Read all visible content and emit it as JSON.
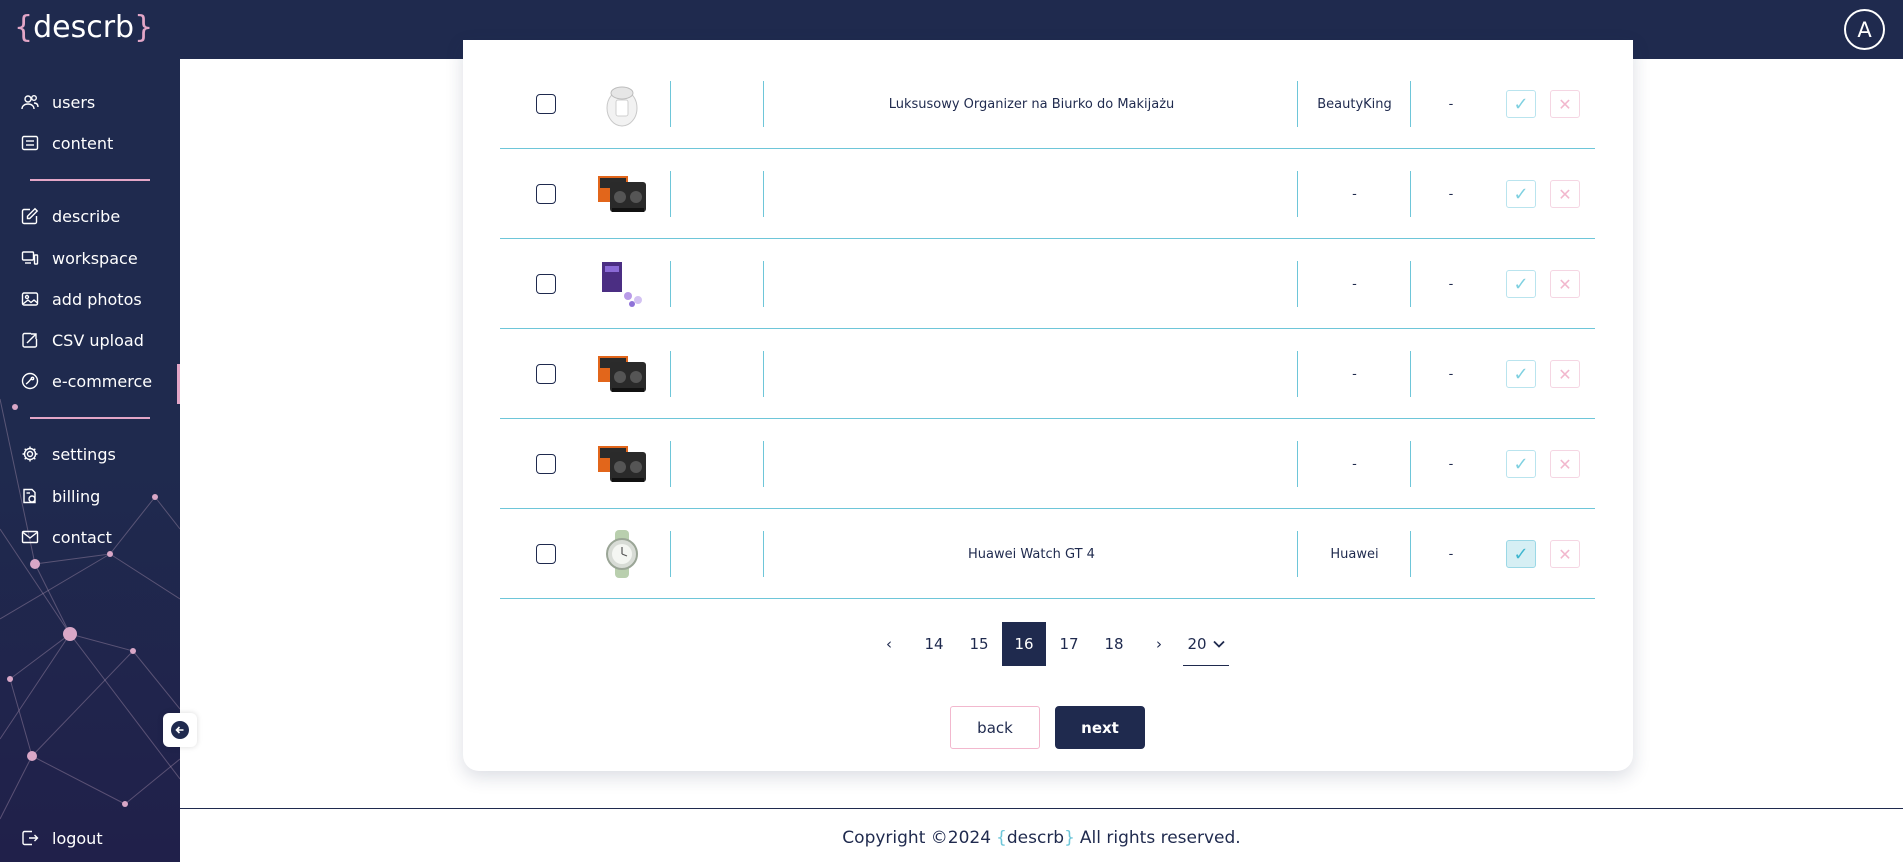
{
  "brand": {
    "open": "{",
    "name": "descrb",
    "close": "}"
  },
  "user": {
    "avatar_letter": "A"
  },
  "sidebar": {
    "items": [
      {
        "label": "users",
        "icon": "users-icon"
      },
      {
        "label": "content",
        "icon": "content-icon"
      },
      {
        "label": "describe",
        "icon": "edit-icon"
      },
      {
        "label": "workspace",
        "icon": "workspace-icon"
      },
      {
        "label": "add photos",
        "icon": "image-icon"
      },
      {
        "label": "CSV upload",
        "icon": "upload-icon"
      },
      {
        "label": "e-commerce",
        "icon": "ecommerce-icon"
      },
      {
        "label": "settings",
        "icon": "gear-icon"
      },
      {
        "label": "billing",
        "icon": "billing-icon"
      },
      {
        "label": "contact",
        "icon": "mail-icon"
      }
    ],
    "logout": "logout"
  },
  "table": {
    "rows": [
      {
        "thumb": "organizer",
        "name": "Luksusowy Organizer na Biurko do Makijażu",
        "brand": "BeautyKing",
        "extra": "-",
        "approved": false
      },
      {
        "thumb": "gpu",
        "name": "",
        "brand": "-",
        "extra": "-",
        "approved": false
      },
      {
        "thumb": "box",
        "name": "",
        "brand": "-",
        "extra": "-",
        "approved": false
      },
      {
        "thumb": "gpu",
        "name": "",
        "brand": "-",
        "extra": "-",
        "approved": false
      },
      {
        "thumb": "gpu",
        "name": "",
        "brand": "-",
        "extra": "-",
        "approved": false
      },
      {
        "thumb": "watch",
        "name": "Huawei Watch GT 4",
        "brand": "Huawei",
        "extra": "-",
        "approved": true
      }
    ]
  },
  "pagination": {
    "prev": "‹",
    "pages": [
      "14",
      "15",
      "16",
      "17",
      "18"
    ],
    "current": "16",
    "next": "›",
    "per_page": "20"
  },
  "actions": {
    "back": "back",
    "next": "next"
  },
  "footer": {
    "prefix": "Copyright ©2024",
    "suffix": "All rights reserved."
  },
  "colors": {
    "navy": "#1f2a4e",
    "pink": "#e3a6c7",
    "teal": "#6ec6d9"
  }
}
